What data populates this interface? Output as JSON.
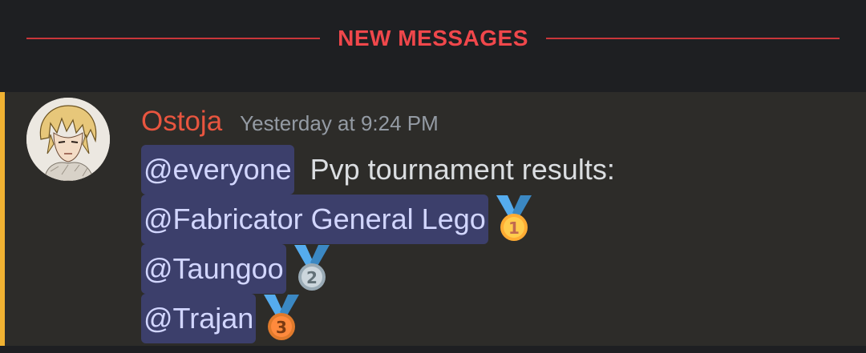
{
  "divider": {
    "label": "NEW MESSAGES",
    "color": "#f0474b"
  },
  "message": {
    "author": "Ostoja",
    "author_color": "#e8553f",
    "timestamp": "Yesterday at 9:24 PM",
    "accent_color": "#f0b232",
    "lines": [
      {
        "mention": "@everyone",
        "text": "Pvp tournament results:"
      },
      {
        "mention": "@Fabricator General Lego",
        "medal": "first-place-medal-icon",
        "medal_number": "1"
      },
      {
        "mention": "@Taungoo",
        "medal": "second-place-medal-icon",
        "medal_number": "2"
      },
      {
        "mention": "@Trajan",
        "medal": "third-place-medal-icon",
        "medal_number": "3"
      }
    ]
  }
}
